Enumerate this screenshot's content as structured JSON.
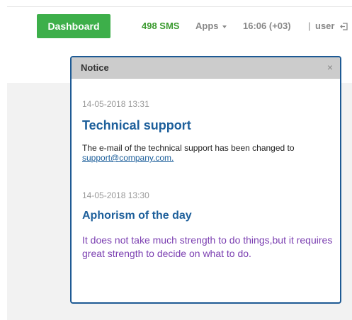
{
  "navbar": {
    "dashboard_label": "Dashboard",
    "sms_count": "498 SMS",
    "apps_label": "Apps",
    "clock": "16:06 (+03)",
    "separator": "|",
    "user_label": "user",
    "colors": {
      "dashboard_bg": "#3daf4a",
      "sms_text": "#3a9a2e",
      "muted_text": "#888888"
    }
  },
  "notice": {
    "title": "Notice",
    "close_glyph": "×",
    "items": [
      {
        "date": "14-05-2018 13:31",
        "title": "Technical support",
        "body_text": "The e-mail of the technical support has been changed to",
        "link_text": "support@company.com."
      },
      {
        "date": "14-05-2018 13:30",
        "title": "Aphorism of the day",
        "body_text": "It does not take much strength to do things,but it requires great strength to decide on what to do."
      }
    ],
    "colors": {
      "border": "#1e5a94",
      "title": "#1d5f9b",
      "aphorism": "#7b3fb1",
      "date": "#999999"
    }
  },
  "icons": {
    "logout": "logout-icon",
    "caret": "chevron-down-icon",
    "close": "close-icon"
  }
}
